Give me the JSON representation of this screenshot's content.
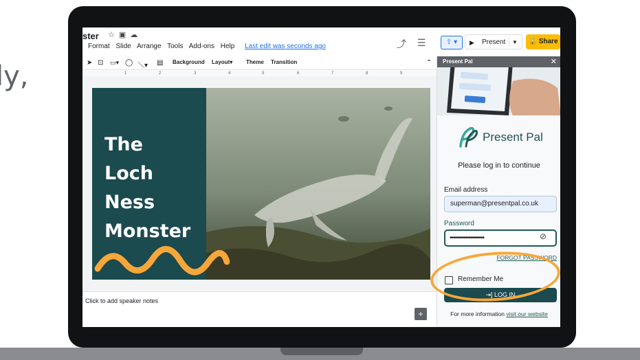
{
  "background_text": "ly,",
  "docs": {
    "title": "ster",
    "menu": [
      "Format",
      "Slide",
      "Arrange",
      "Tools",
      "Add-ons",
      "Help"
    ],
    "last_edit": "Last edit was seconds ago",
    "present_label": "Present",
    "share_label": "Share",
    "toolbar": {
      "background": "Background",
      "layout": "Layout",
      "theme": "Theme",
      "transition": "Transition"
    },
    "ruler_numbers": [
      "1",
      "2",
      "3",
      "4",
      "5",
      "6",
      "7",
      "8",
      "9"
    ],
    "speaker_notes_placeholder": "Click to add speaker notes"
  },
  "slide": {
    "title_lines": [
      "The",
      "Loch",
      "Ness",
      "Monster"
    ],
    "colors": {
      "panel": "#1b4a4f",
      "squiggle": "#f7a73a"
    }
  },
  "sidebar": {
    "header_title": "Present Pal",
    "brand_name": "Present Pal",
    "prompt": "Please log in to continue",
    "email_label": "Email address",
    "email_value": "superman@presentpal.co.uk",
    "password_label": "Password",
    "password_value": "••••••••••••••••••••",
    "forgot_password": "FORGOT PASSWORD",
    "remember_me": "Remember Me",
    "login_button": "LOG IN",
    "more_info": "For more information",
    "website_link": "visit our website",
    "colors": {
      "accent": "#1f5a53",
      "highlight_ring": "#f7a73a"
    }
  }
}
